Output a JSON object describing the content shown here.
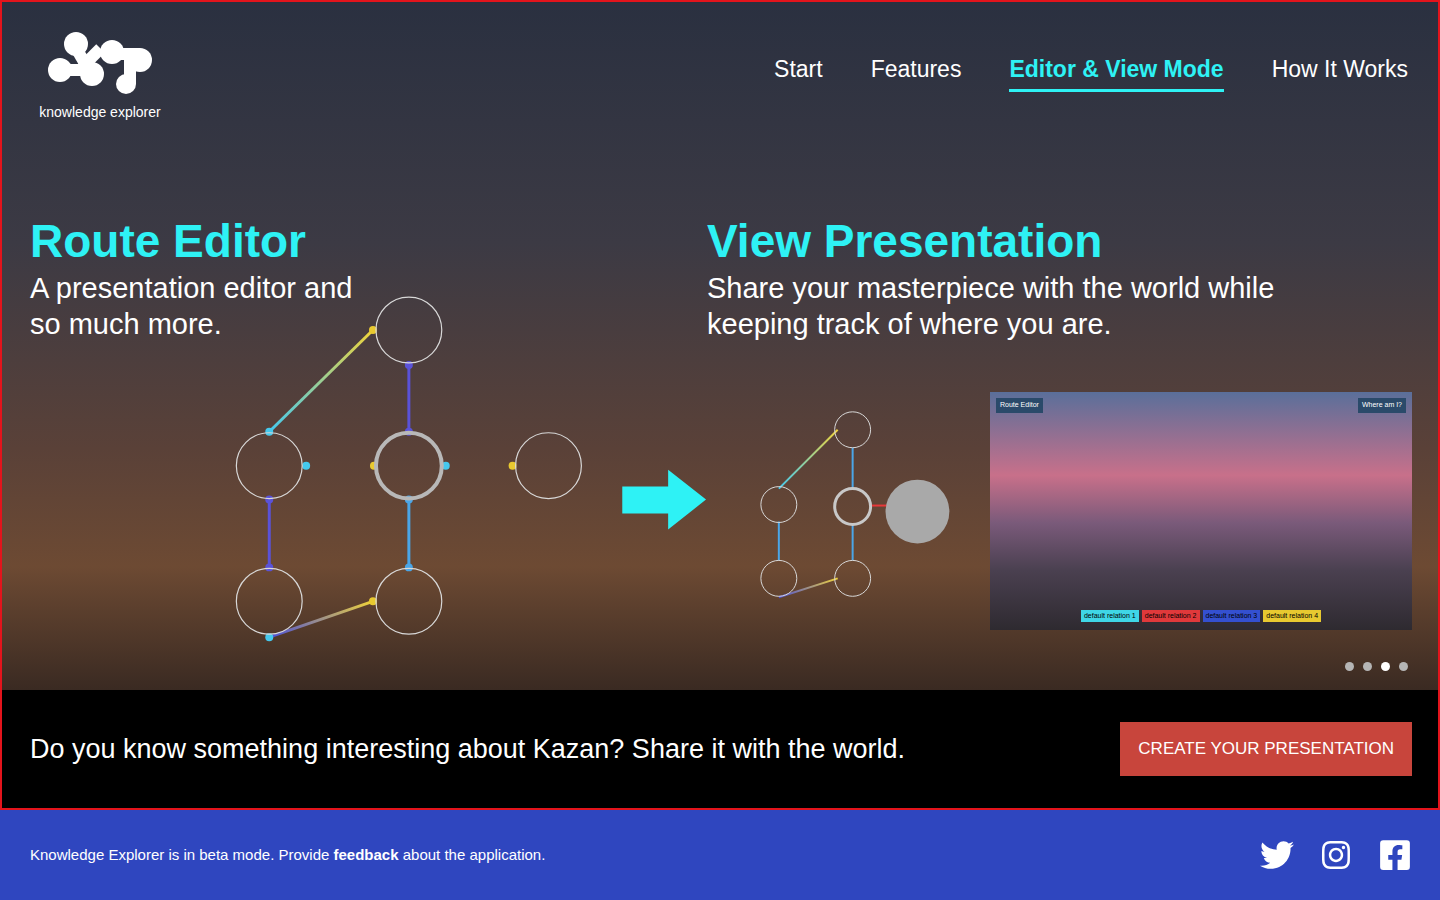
{
  "logo": {
    "text": "knowledge explorer"
  },
  "nav": [
    {
      "label": "Start",
      "selected": false
    },
    {
      "label": "Features",
      "selected": false
    },
    {
      "label": "Editor & View Mode",
      "selected": true
    },
    {
      "label": "How It Works",
      "selected": false
    }
  ],
  "route_editor": {
    "title": "Route Editor",
    "subtitle": "A presentation editor and so much more."
  },
  "view_presentation": {
    "title": "View Presentation",
    "subtitle": "Share your masterpiece with the world while keeping track of where you are."
  },
  "preview": {
    "left_button": "Route Editor",
    "right_button": "Where am I?",
    "tags": [
      {
        "label": "default relation 1",
        "color": "#3fd6e6"
      },
      {
        "label": "default relation 2",
        "color": "#e0393b"
      },
      {
        "label": "default relation 3",
        "color": "#3450d0"
      },
      {
        "label": "default relation 4",
        "color": "#e8c930"
      }
    ]
  },
  "carousel": [
    {
      "selected": false
    },
    {
      "selected": false
    },
    {
      "selected": true
    },
    {
      "selected": false
    }
  ],
  "cta": {
    "text": "Do you know something interesting about Kazan? Share it with the world.",
    "button": "CREATE YOUR PRESENTATION"
  },
  "footer": {
    "text_before": "Knowledge Explorer is in beta mode. Provide ",
    "link": "feedback",
    "text_after": " about the application."
  }
}
